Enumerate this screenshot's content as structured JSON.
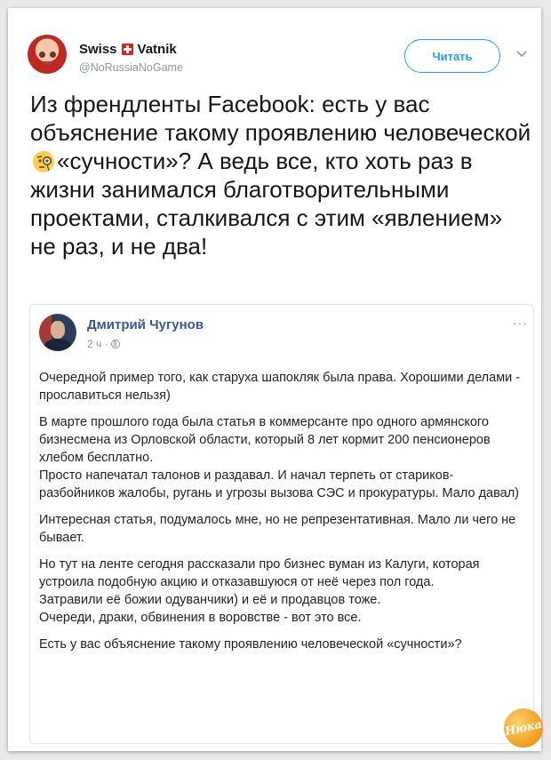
{
  "tweet": {
    "author_name": "Swiss",
    "author_name_2": "Vatnik",
    "handle": "@NoRussiaNoGame",
    "follow_label": "Читать",
    "text_before": "Из френдленты Facebook: есть у вас объяснение такому проявлению человеческой ",
    "text_after": "«сучности»? А ведь все, кто хоть раз в жизни занимался благотворительными проектами, сталкивался с этим «явлением» не раз, и не два!"
  },
  "embed": {
    "author": "Дмитрий Чугунов",
    "time": "2 ч ·",
    "more": "···",
    "paragraphs": [
      "Очередной пример того, как старуха шапокляк была права. Хорошими делами - прославиться нельзя)",
      "В марте прошлого года была статья в коммерсанте про одного армянского бизнесмена из Орловской области, который 8 лет кормит 200 пенсионеров хлебом бесплатно.\nПросто напечатал талонов и раздавал. И начал терпеть от стариков-разбойников жалобы, ругань и угрозы вызова СЭС и прокуратуры. Мало давал)",
      "Интересная статья, подумалось мне, но не репрезентативная. Мало ли чего не бывает.",
      "Но тут на ленте сегодня рассказали про бизнес вуман из Калуги, которая устроила подобную акцию и отказавшуюся от неё через пол года.\nЗатравили её божии одуванчики) и её и продавцов тоже.\nОчереди, драки, обвинения в воровстве - вот это все.",
      "Есть у вас объяснение такому проявлению человеческой «сучности»?"
    ]
  },
  "watermark": "Нюка",
  "icons": {
    "flag": "swiss-flag-icon",
    "emoji": "face-with-monocle-icon",
    "caret": "chevron-down-icon",
    "privacy": "globe-icon"
  },
  "colors": {
    "accent": "#1da1f2",
    "fb_name": "#365899"
  }
}
